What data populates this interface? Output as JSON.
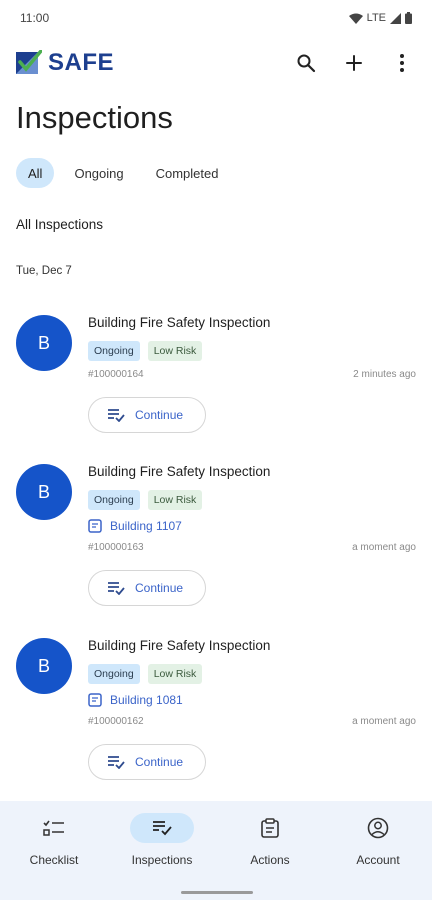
{
  "status_bar": {
    "time": "11:00",
    "network": "LTE"
  },
  "app_bar": {
    "logo_text": "SAFE"
  },
  "page": {
    "title": "Inspections"
  },
  "filters": [
    "All",
    "Ongoing",
    "Completed"
  ],
  "section_title": "All Inspections",
  "date_label": "Tue, Dec 7",
  "inspections": [
    {
      "avatar": "B",
      "title": "Building Fire Safety Inspection",
      "status": "Ongoing",
      "risk": "Low Risk",
      "building": "",
      "id": "#100000164",
      "time": "2 minutes ago",
      "action": "Continue"
    },
    {
      "avatar": "B",
      "title": "Building Fire Safety Inspection",
      "status": "Ongoing",
      "risk": "Low Risk",
      "building": "Building 1107",
      "id": "#100000163",
      "time": "a moment ago",
      "action": "Continue"
    },
    {
      "avatar": "B",
      "title": "Building Fire Safety Inspection",
      "status": "Ongoing",
      "risk": "Low Risk",
      "building": "Building 1081",
      "id": "#100000162",
      "time": "a moment ago",
      "action": "Continue"
    }
  ],
  "bottom_nav": [
    "Checklist",
    "Inspections",
    "Actions",
    "Account"
  ],
  "colors": {
    "brand": "#1d3f8f",
    "avatar": "#1554c9",
    "chip_active": "#cfe7fb",
    "link": "#3b64c9",
    "nav_bg": "#eef3fb"
  }
}
